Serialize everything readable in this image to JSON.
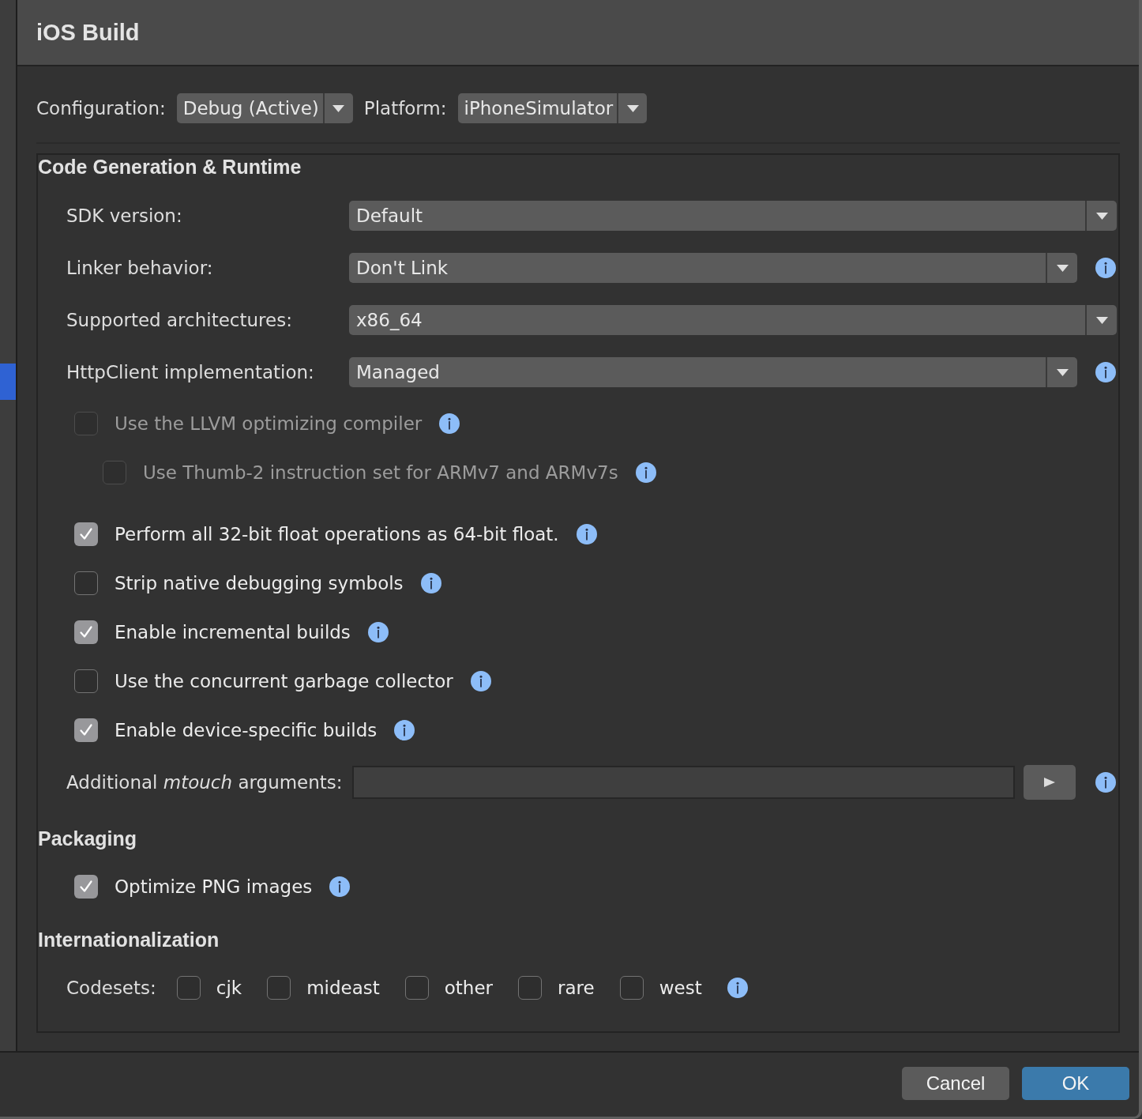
{
  "window": {
    "title": "iOS Build"
  },
  "toolbar": {
    "fields": [
      {
        "label": "Configuration:",
        "value": "Debug (Active)"
      },
      {
        "label": "Platform:",
        "value": "iPhoneSimulator"
      }
    ]
  },
  "sections": [
    {
      "title": "Code Generation & Runtime",
      "items": [
        {
          "kind": "dropdown",
          "label": "SDK version:",
          "value": "Default",
          "info": false
        },
        {
          "kind": "dropdown",
          "label": "Linker behavior:",
          "value": "Don't Link",
          "info": true
        },
        {
          "kind": "dropdown",
          "label": "Supported architectures:",
          "value": "x86_64",
          "info": false
        },
        {
          "kind": "dropdown",
          "label": "HttpClient implementation:",
          "value": "Managed",
          "info": true
        },
        {
          "kind": "checkbox",
          "label": "Use the LLVM optimizing compiler",
          "checked": false,
          "disabled": true,
          "info": true,
          "children": [
            {
              "kind": "checkbox",
              "label": "Use Thumb-2 instruction set for ARMv7 and ARMv7s",
              "checked": false,
              "disabled": true,
              "info": true
            }
          ]
        },
        {
          "kind": "checkbox",
          "label": "Perform all 32-bit float operations as 64-bit float.",
          "checked": true,
          "disabled": false,
          "info": true
        },
        {
          "kind": "checkbox",
          "label": "Strip native debugging symbols",
          "checked": false,
          "disabled": false,
          "info": true
        },
        {
          "kind": "checkbox",
          "label": "Enable incremental builds",
          "checked": true,
          "disabled": false,
          "info": true
        },
        {
          "kind": "checkbox",
          "label": "Use the concurrent garbage collector",
          "checked": false,
          "disabled": false,
          "info": true
        },
        {
          "kind": "checkbox",
          "label": "Enable device-specific builds",
          "checked": true,
          "disabled": false,
          "info": true
        },
        {
          "kind": "text_field",
          "label": "Additional *mtouch* arguments:",
          "info": true
        }
      ]
    },
    {
      "title": "Packaging",
      "items": [
        {
          "kind": "checkbox",
          "label": "Optimize PNG images",
          "checked": true,
          "disabled": false,
          "info": true
        }
      ]
    },
    {
      "title": "Internationalization",
      "items": [
        {
          "kind": "checkbox_group",
          "label": "Codesets:",
          "info": true,
          "options": [
            {
              "label": "cjk",
              "checked": false
            },
            {
              "label": "mideast",
              "checked": false
            },
            {
              "label": "other",
              "checked": false
            },
            {
              "label": "rare",
              "checked": false
            },
            {
              "label": "west",
              "checked": false
            }
          ]
        }
      ]
    }
  ],
  "buttons": [
    {
      "label": "Cancel",
      "kind": "secondary"
    },
    {
      "label": "OK",
      "kind": "primary"
    }
  ]
}
